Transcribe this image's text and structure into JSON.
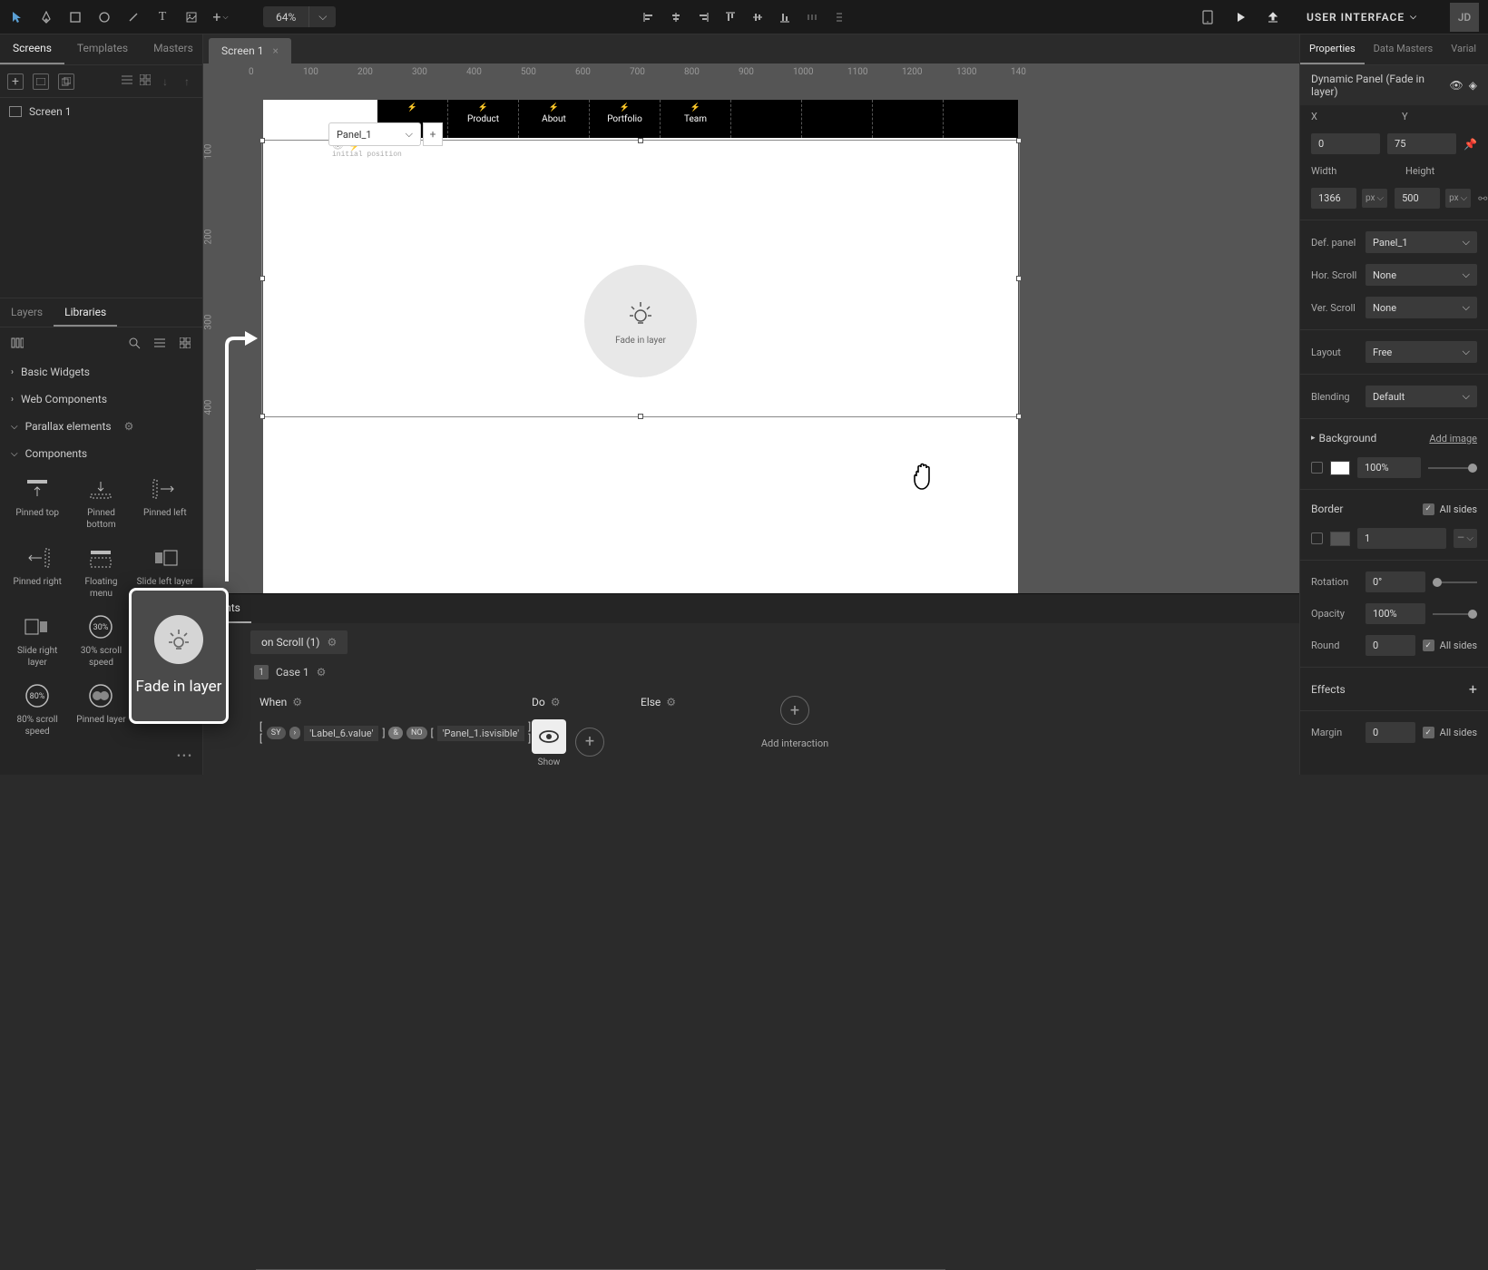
{
  "toolbar": {
    "zoom": "64%",
    "ui_label": "USER INTERFACE",
    "user_initials": "JD"
  },
  "left": {
    "tabs": [
      "Screens",
      "Templates",
      "Masters"
    ],
    "active_tab": "Screens",
    "screen_name": "Screen 1",
    "layers_tabs": [
      "Layers",
      "Libraries"
    ],
    "active_layers_tab": "Libraries",
    "sections": {
      "basic": "Basic Widgets",
      "web": "Web Components",
      "parallax": "Parallax elements",
      "components": "Components"
    },
    "components": [
      "Pinned top",
      "Pinned bottom",
      "Pinned left",
      "Pinned right",
      "Floating menu",
      "Slide left layer",
      "Slide right layer",
      "30% scroll speed",
      "",
      "80% scroll speed",
      "Pinned layer",
      ""
    ],
    "fade_card": "Fade in layer"
  },
  "canvas": {
    "tab_name": "Screen 1",
    "nav_items": [
      "",
      "Product",
      "About",
      "Portfolio",
      "Team",
      "",
      "",
      ""
    ],
    "panel_name": "Panel_1",
    "initial_position": "initial position",
    "fade_label": "Fade in layer",
    "ruler_h": [
      "0",
      "100",
      "200",
      "300",
      "400",
      "500",
      "600",
      "700",
      "800",
      "900",
      "1000",
      "1100",
      "1200",
      "1300",
      "140"
    ],
    "ruler_v": [
      "100",
      "200",
      "300",
      "400"
    ]
  },
  "props": {
    "tabs": [
      "Properties",
      "Data Masters",
      "Varial"
    ],
    "active_tab": "Properties",
    "title": "Dynamic Panel (Fade in layer)",
    "x_label": "X",
    "x_val": "0",
    "y_label": "Y",
    "y_val": "75",
    "width_label": "Width",
    "width_val": "1366",
    "height_label": "Height",
    "height_val": "500",
    "unit": "px",
    "def_panel_label": "Def. panel",
    "def_panel_val": "Panel_1",
    "hor_scroll_label": "Hor. Scroll",
    "hor_scroll_val": "None",
    "ver_scroll_label": "Ver. Scroll",
    "ver_scroll_val": "None",
    "layout_label": "Layout",
    "layout_val": "Free",
    "blending_label": "Blending",
    "blending_val": "Default",
    "background_label": "Background",
    "background_pct": "100%",
    "add_image": "Add image",
    "border_label": "Border",
    "border_val": "1",
    "all_sides": "All sides",
    "rotation_label": "Rotation",
    "rotation_val": "0°",
    "opacity_label": "Opacity",
    "opacity_val": "100%",
    "round_label": "Round",
    "round_val": "0",
    "effects_label": "Effects",
    "margin_label": "Margin",
    "margin_val": "0"
  },
  "events": {
    "tab": "  vents",
    "trigger": "on Scroll (1)",
    "case": "Case 1",
    "when": "When",
    "do": "Do",
    "else": "Else",
    "cond_left": "'Label_6.value'",
    "cond_right": "'Panel_1.isvisible'",
    "show": "Show",
    "add_interaction": "Add interaction"
  }
}
